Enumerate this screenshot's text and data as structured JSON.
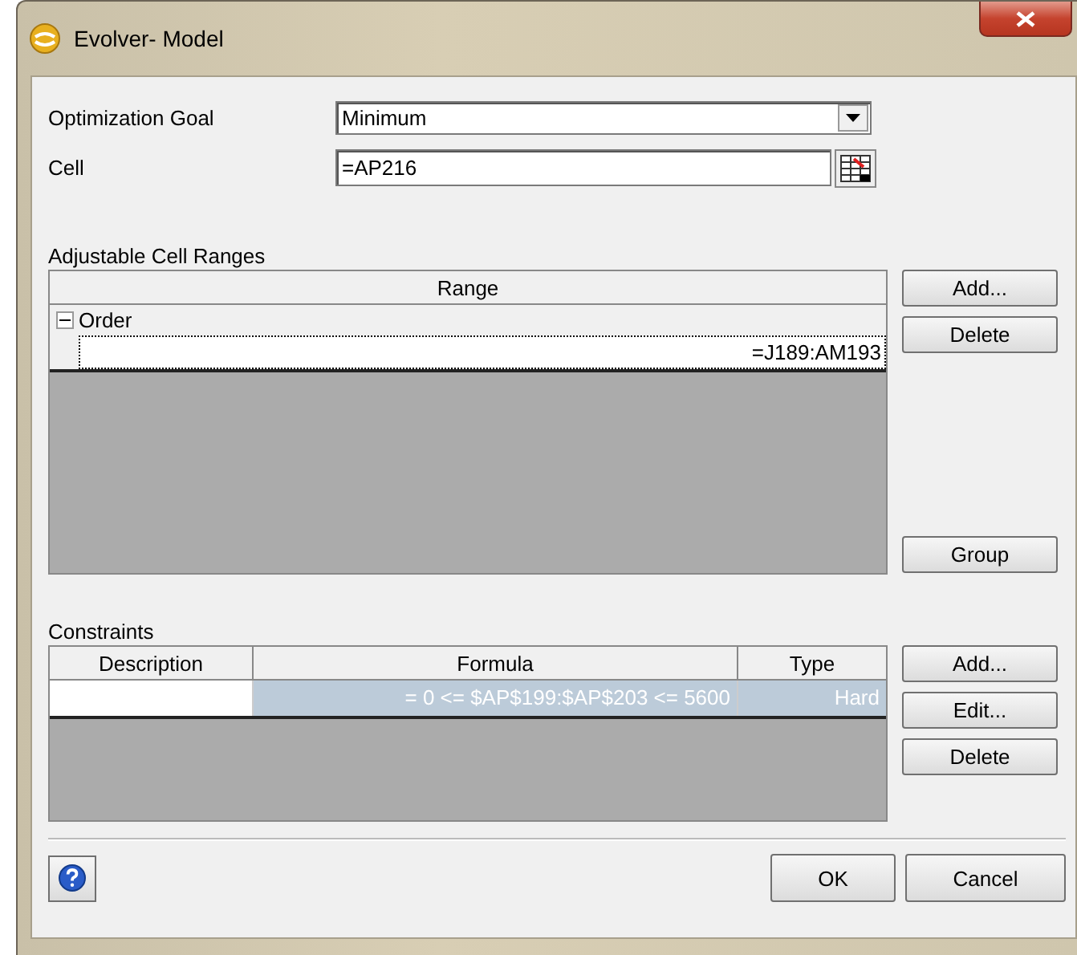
{
  "window": {
    "title": "Evolver- Model"
  },
  "optimization_goal": {
    "label": "Optimization Goal",
    "value": "Minimum"
  },
  "cell": {
    "label": "Cell",
    "value": "=AP216"
  },
  "adjustable_ranges": {
    "label": "Adjustable Cell Ranges",
    "column": "Range",
    "groups": [
      {
        "name": "Order",
        "expanded": true,
        "children": [
          {
            "range": "=J189:AM193",
            "selected": true
          }
        ]
      }
    ],
    "buttons": [
      "Add...",
      "Delete",
      "Group"
    ]
  },
  "constraints": {
    "label": "Constraints",
    "columns": [
      "Description",
      "Formula",
      "Type"
    ],
    "rows": [
      {
        "description": "",
        "formula": "= 0 <= $AP$199:$AP$203 <=  5600",
        "type": "Hard",
        "selected": true
      }
    ],
    "buttons": [
      "Add...",
      "Edit...",
      "Delete"
    ]
  },
  "footer_buttons": [
    "OK",
    "Cancel"
  ]
}
